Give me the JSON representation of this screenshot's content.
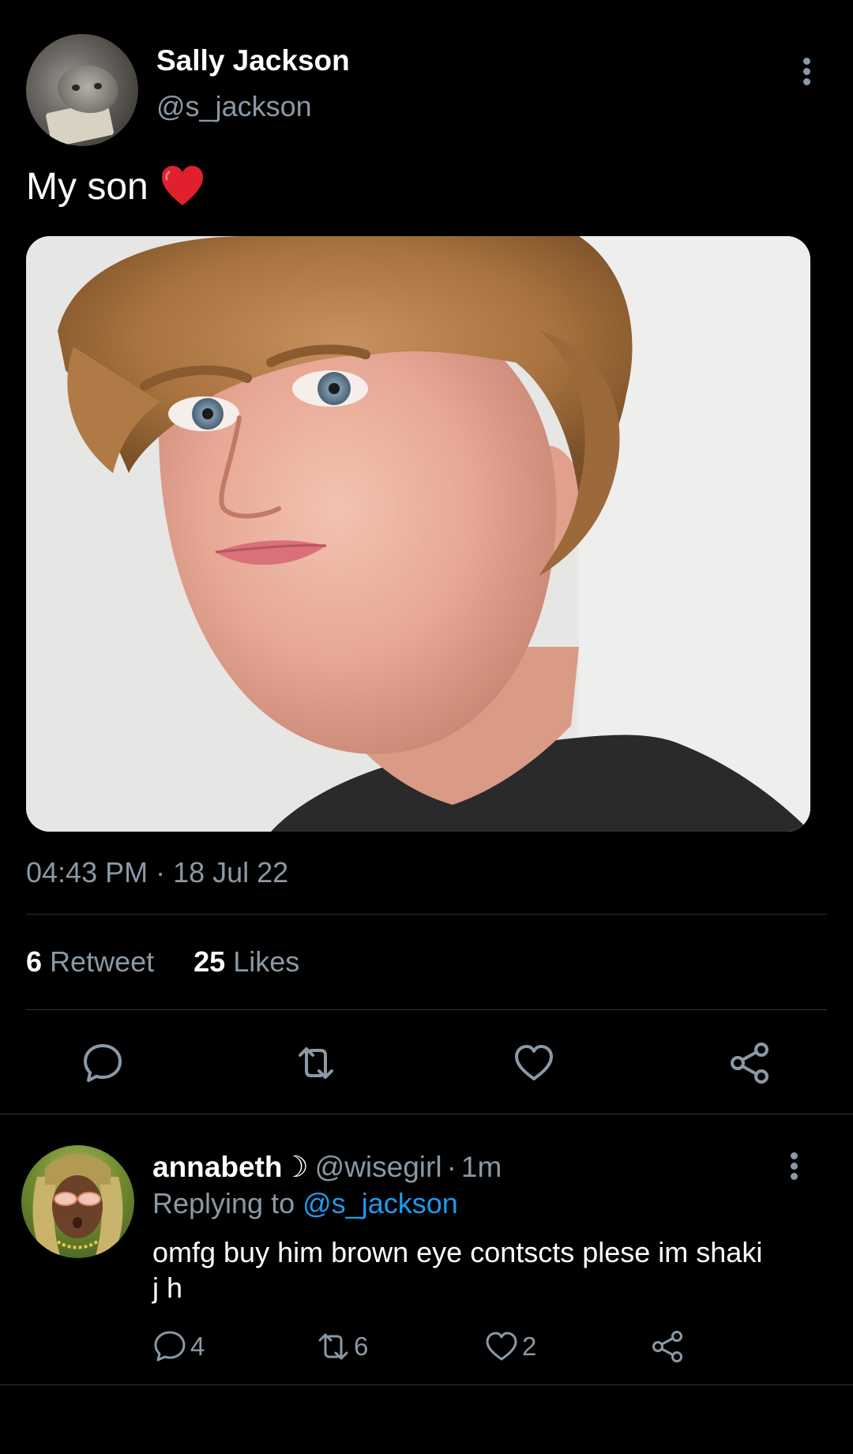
{
  "tweet": {
    "author": {
      "name": "Sally Jackson",
      "handle": "@s_jackson"
    },
    "text": "My son",
    "emoji": "red-heart",
    "photo": {
      "subject": "portrait photo"
    },
    "timestamp": "04:43 PM · 18 Jul 22",
    "stats": {
      "retweets_count": "6",
      "retweets_label": "Retweet",
      "likes_count": "25",
      "likes_label": "Likes"
    },
    "actions": [
      "reply-icon",
      "retweet-icon",
      "like-icon",
      "share-icon"
    ]
  },
  "reply": {
    "author": {
      "name": "annabeth☽",
      "handle": "@wisegirl",
      "separator": "·",
      "time": "1m"
    },
    "replying_to_label": "Replying to",
    "replying_to_handle": "@s_jackson",
    "text": "omfg buy him brown eye contscts plese im shaki j h",
    "counts": {
      "replies": "4",
      "retweets": "6",
      "likes": "2"
    }
  },
  "colors": {
    "background": "#000000",
    "primary_text": "#ffffff",
    "secondary_text": "#8b98a5",
    "link": "#1d9bf0",
    "divider": "#2f3336",
    "heart": "#e0202d"
  }
}
